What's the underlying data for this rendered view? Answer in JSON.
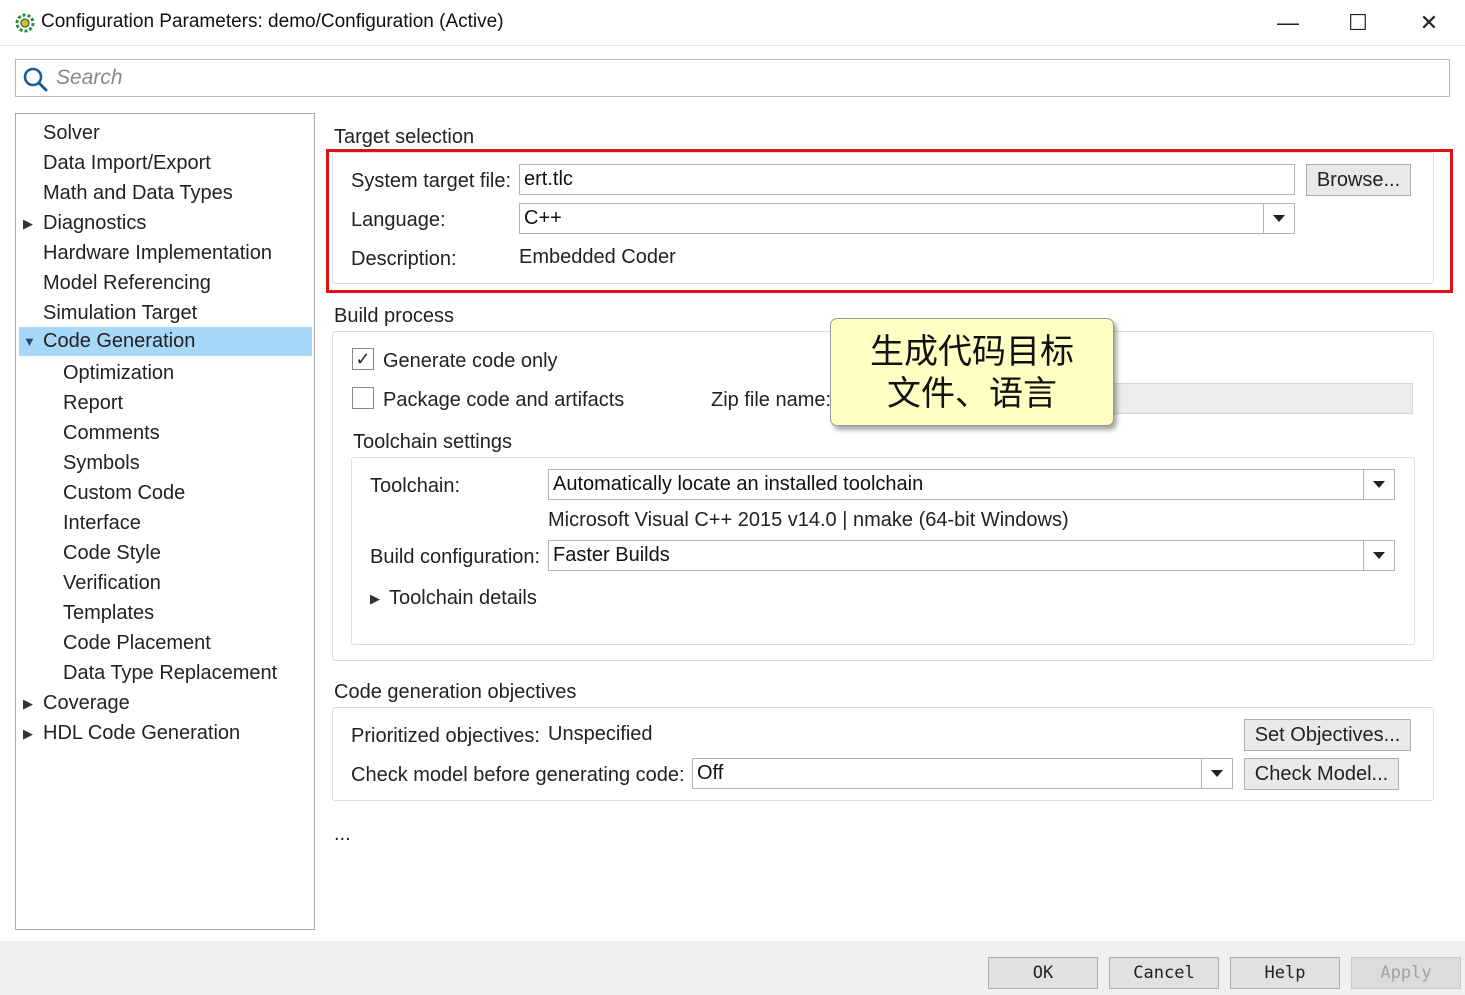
{
  "window": {
    "title": "Configuration Parameters: demo/Configuration (Active)",
    "minimize_glyph": "—",
    "maximize_glyph": "☐",
    "close_glyph": "✕"
  },
  "search": {
    "placeholder": "Search"
  },
  "tree": {
    "items": [
      {
        "label": "Solver"
      },
      {
        "label": "Data Import/Export"
      },
      {
        "label": "Math and Data Types"
      },
      {
        "label": "Diagnostics"
      },
      {
        "label": "Hardware Implementation"
      },
      {
        "label": "Model Referencing"
      },
      {
        "label": "Simulation Target"
      },
      {
        "label": "Code Generation"
      },
      {
        "label": "Optimization"
      },
      {
        "label": "Report"
      },
      {
        "label": "Comments"
      },
      {
        "label": "Symbols"
      },
      {
        "label": "Custom Code"
      },
      {
        "label": "Interface"
      },
      {
        "label": "Code Style"
      },
      {
        "label": "Verification"
      },
      {
        "label": "Templates"
      },
      {
        "label": "Code Placement"
      },
      {
        "label": "Data Type Replacement"
      },
      {
        "label": "Coverage"
      },
      {
        "label": "HDL Code Generation"
      }
    ]
  },
  "target_selection": {
    "heading": "Target selection",
    "system_target_file_label": "System target file:",
    "system_target_file_value": "ert.tlc",
    "browse_label": "Browse...",
    "language_label": "Language:",
    "language_value": "C++",
    "description_label": "Description:",
    "description_value": "Embedded Coder"
  },
  "build_process": {
    "heading": "Build process",
    "generate_code_only_label": "Generate code only",
    "generate_code_only_checked": true,
    "check_glyph": "✓",
    "package_code_label": "Package code and artifacts",
    "package_code_checked": false,
    "zip_file_label": "Zip file name:",
    "toolchain_settings_heading": "Toolchain settings",
    "toolchain_label": "Toolchain:",
    "toolchain_value": "Automatically locate an installed toolchain",
    "toolchain_info": "Microsoft Visual C++ 2015 v14.0 | nmake (64-bit Windows)",
    "build_configuration_label": "Build configuration:",
    "build_configuration_value": "Faster Builds",
    "toolchain_details_label": "Toolchain details"
  },
  "objectives": {
    "heading": "Code generation objectives",
    "prioritized_label": "Prioritized objectives:",
    "prioritized_value": "Unspecified",
    "set_objectives_label": "Set Objectives...",
    "check_model_label": "Check model before generating code:",
    "check_model_value": "Off",
    "check_model_button_label": "Check Model..."
  },
  "ellipsis": "...",
  "callout": {
    "line1": "生成代码目标",
    "line2": "文件、语言"
  },
  "footer": {
    "ok_label": "OK",
    "cancel_label": "Cancel",
    "help_label": "Help",
    "apply_label": "Apply"
  },
  "colors": {
    "selection": "#a8d8f8",
    "highlight_box": "#e0101a",
    "callout_bg": "#ffffc4"
  }
}
